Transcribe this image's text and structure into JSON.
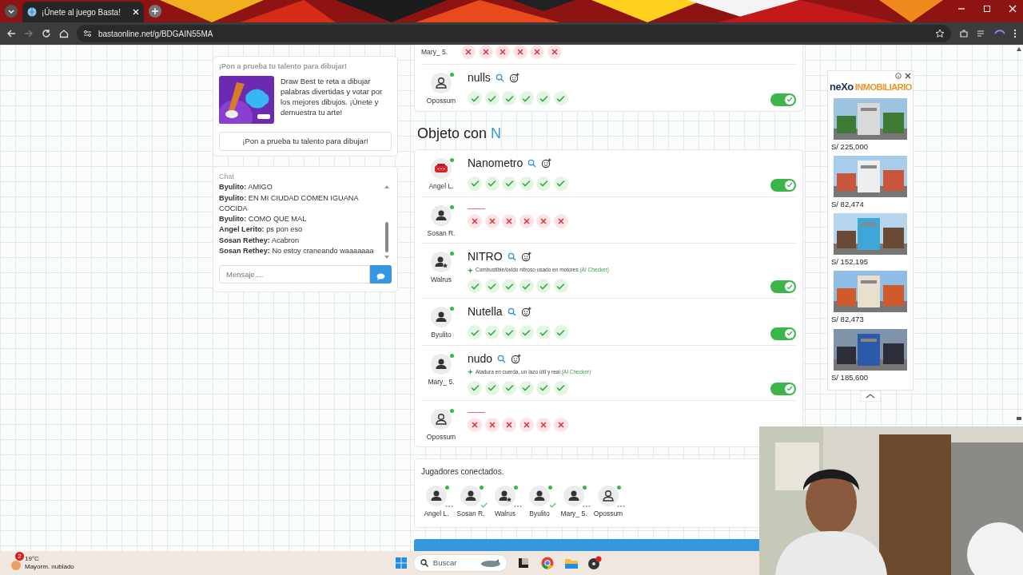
{
  "browser": {
    "tab_title": "¡Únete al juego Basta!",
    "url": "bastaonline.net/g/BDGAIN55MA"
  },
  "promo": {
    "title": "¡Pon a prueba tu talento para dibujar!",
    "text": "Draw Best te reta a dibujar palabras divertidas y votar por los mejores dibujos. ¡Únete y demuestra tu arte!",
    "button": "¡Pon a prueba tu talento para dibujar!"
  },
  "chat": {
    "title": "Chat",
    "messages": [
      {
        "user": "Byulito:",
        "text": "AMIGO"
      },
      {
        "user": "Byulito:",
        "text": "EN MI CIUDAD COMEN IGUANA COCIDA"
      },
      {
        "user": "Byulito:",
        "text": "COMO QUE MAL"
      },
      {
        "user": "Angel Lerito:",
        "text": "ps pon eso"
      },
      {
        "user": "Sosan Rethey:",
        "text": "Acabron"
      },
      {
        "user": "Sosan Rethey:",
        "text": "No estoy craneando waaaaaaa"
      }
    ],
    "placeholder": "Mensaje...."
  },
  "sections": [
    {
      "rows": [
        {
          "kind": "cut",
          "player": "Mary_ 5.",
          "results": [
            false,
            false,
            false,
            false,
            false,
            false
          ]
        },
        {
          "kind": "answered",
          "player": "Opossum",
          "avatar": {
            "kind": "outline"
          },
          "word": "nulls",
          "results": [
            true,
            true,
            true,
            true,
            true,
            true
          ],
          "approved": true
        }
      ]
    },
    {
      "title": "Objeto con",
      "letter": "N",
      "rows": [
        {
          "kind": "answered",
          "player": "Angel L.",
          "avatar": {
            "kind": "stop"
          },
          "word": "Nanometro",
          "results": [
            true,
            true,
            true,
            true,
            true,
            true
          ],
          "approved": true
        },
        {
          "kind": "blank",
          "player": "Sosan R.",
          "avatar": {
            "kind": "user"
          },
          "results": [
            false,
            false,
            false,
            false,
            false,
            false
          ]
        },
        {
          "kind": "answered",
          "player": "Walrus",
          "avatar": {
            "kind": "star"
          },
          "word": "NITRO",
          "hint": "Combustible/óxido nitroso usado en motores",
          "hint_source": "(AI Checker)",
          "results": [
            true,
            true,
            true,
            true,
            true,
            true
          ],
          "approved": true
        },
        {
          "kind": "answered",
          "player": "Byulito",
          "avatar": {
            "kind": "user"
          },
          "word": "Nutella",
          "results": [
            true,
            true,
            true,
            true,
            true,
            true
          ],
          "approved": true
        },
        {
          "kind": "answered",
          "player": "Mary_ 5.",
          "avatar": {
            "kind": "user"
          },
          "word": "nudo",
          "hint": "Atadura en cuerda, un lazo útil y real",
          "hint_source": "(AI Checker)",
          "results": [
            true,
            true,
            true,
            true,
            true,
            true
          ],
          "approved": true
        },
        {
          "kind": "blank",
          "player": "Opossum",
          "avatar": {
            "kind": "outline"
          },
          "results": [
            false,
            false,
            false,
            false,
            false,
            false
          ]
        }
      ]
    }
  ],
  "connected": {
    "title": "Jugadores conectados.",
    "players": [
      {
        "name": "Angel L.",
        "avatar": {
          "kind": "user"
        },
        "done": false
      },
      {
        "name": "Sosan R.",
        "avatar": {
          "kind": "user"
        },
        "done": true
      },
      {
        "name": "Walrus",
        "avatar": {
          "kind": "star"
        },
        "done": false
      },
      {
        "name": "Byulito",
        "avatar": {
          "kind": "user"
        },
        "done": true
      },
      {
        "name": "Mary_ 5.",
        "avatar": {
          "kind": "user"
        },
        "done": false
      },
      {
        "name": "Opossum",
        "avatar": {
          "kind": "outline"
        },
        "done": false
      }
    ]
  },
  "ad": {
    "logo": "neXo",
    "logo_suffix": "INMOBILIARIO",
    "listings": [
      {
        "price": "S/ 225,000"
      },
      {
        "price": "S/ 82,474"
      },
      {
        "price": "S/ 152,195"
      },
      {
        "price": "S/ 82,473"
      },
      {
        "price": "S/ 185,600"
      }
    ]
  },
  "taskbar": {
    "temperature": "19°C",
    "weather": "Mayorm. nublado",
    "weather_badge": "2",
    "search_placeholder": "Buscar"
  }
}
